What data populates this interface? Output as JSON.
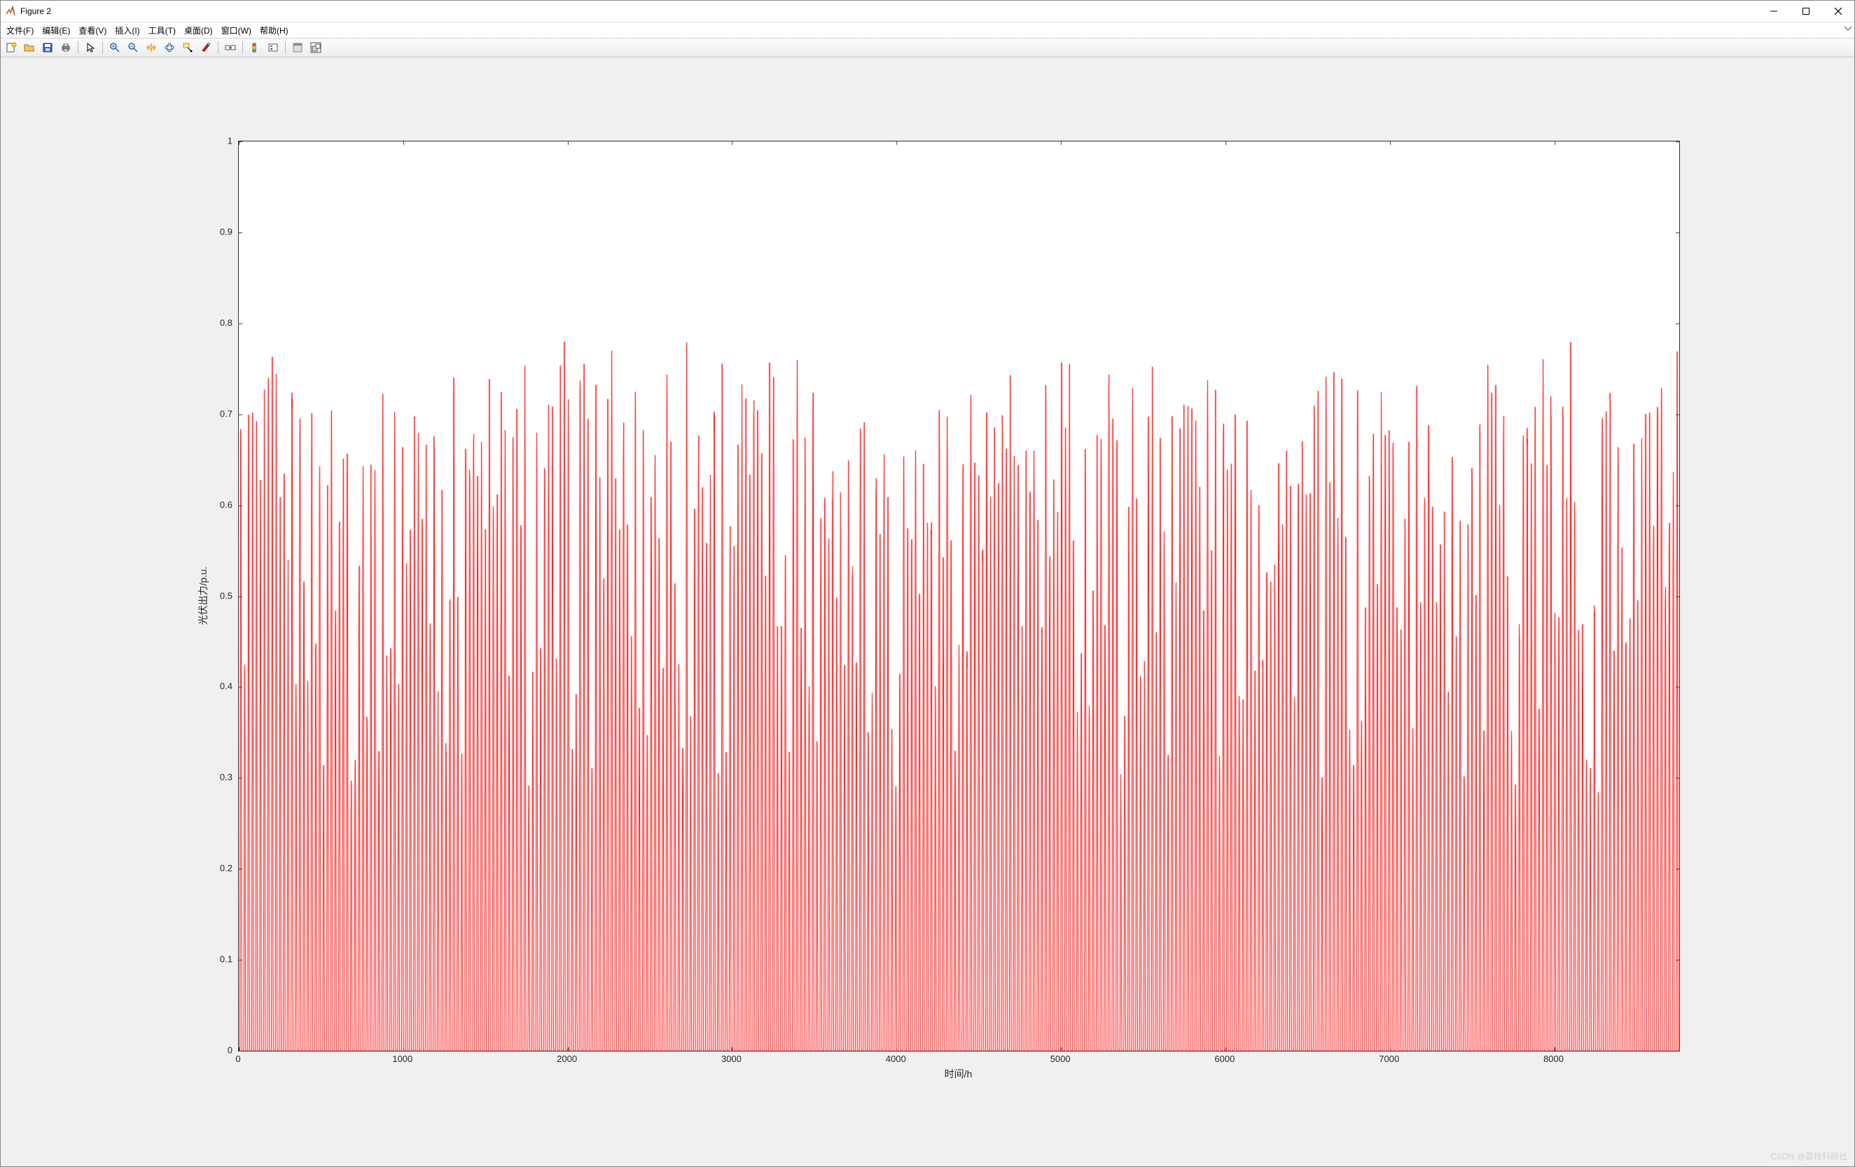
{
  "window": {
    "title": "Figure 2",
    "buttons": {
      "minimize": "–",
      "maximize": "▢",
      "close": "✕"
    }
  },
  "menubar": {
    "items": [
      "文件(F)",
      "编辑(E)",
      "查看(V)",
      "插入(I)",
      "工具(T)",
      "桌面(D)",
      "窗口(W)",
      "帮助(H)"
    ]
  },
  "toolbar": {
    "names": [
      "new-figure-icon",
      "open-file-icon",
      "save-icon",
      "print-icon",
      "sep",
      "pointer-icon",
      "sep",
      "zoom-in-icon",
      "zoom-out-icon",
      "pan-icon",
      "rotate3d-icon",
      "data-cursor-icon",
      "brush-icon",
      "sep",
      "link-plot-icon",
      "sep",
      "colorbar-icon",
      "legend-icon",
      "sep",
      "hide-tools-icon",
      "dock-icon"
    ]
  },
  "watermark": "CSDN @荔枝科研社",
  "chart_data": {
    "type": "line",
    "title": "",
    "xlabel": "时间/h",
    "ylabel": "光伏出力/p.u.",
    "xlim": [
      0,
      8760
    ],
    "ylim": [
      0,
      1
    ],
    "x_ticks": [
      0,
      1000,
      2000,
      3000,
      4000,
      5000,
      6000,
      7000,
      8000
    ],
    "y_ticks": [
      0,
      0.1,
      0.2,
      0.3,
      0.4,
      0.5,
      0.6,
      0.7,
      0.8,
      0.9,
      1
    ],
    "color": "#ff0000",
    "description": "Hourly PV (photovoltaic) power output in per-unit for one year (8760 hours). The curve consists of 365 daily pulses that rise from 0 p.u. at night to a daytime peak ranging roughly between 0.3 and 0.8 p.u., then return to 0. Median peak is roughly 0.65–0.7 p.u.; maximum observed peak ≈0.80 p.u.; many days peak below 0.5. No data above roughly 0.8 p.u.",
    "num_days": 365,
    "hours_per_day": 24,
    "daylight_hours": {
      "start": 6,
      "end": 18
    },
    "daily_peak_summary": {
      "min_peak_pu": 0.3,
      "median_peak_pu": 0.68,
      "max_peak_pu": 0.8
    }
  }
}
